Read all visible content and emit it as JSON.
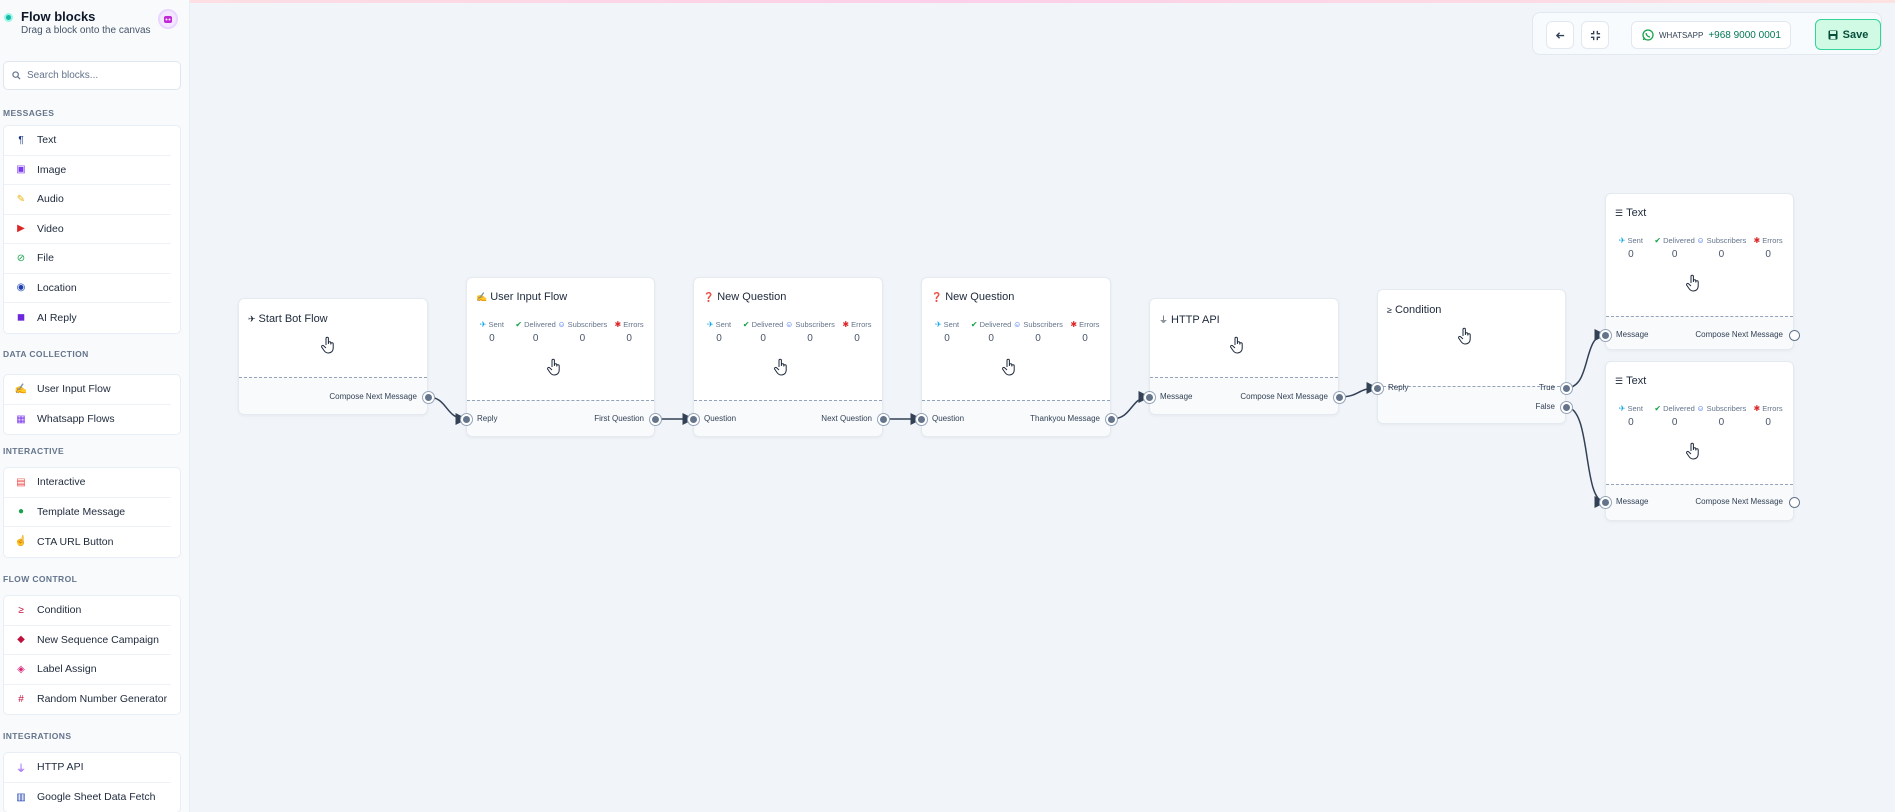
{
  "sidebar": {
    "title": "Flow blocks",
    "subtitle": "Drag a block onto the canvas",
    "search_placeholder": "Search blocks...",
    "sections": [
      {
        "label": "MESSAGES",
        "items": [
          {
            "label": "Text",
            "icon": "paragraph-icon",
            "color": "#1e3a8a"
          },
          {
            "label": "Image",
            "icon": "image-icon",
            "color": "#7c3aed"
          },
          {
            "label": "Audio",
            "icon": "audio-icon",
            "color": "#eab308"
          },
          {
            "label": "Video",
            "icon": "video-icon",
            "color": "#dc2626"
          },
          {
            "label": "File",
            "icon": "paperclip-icon",
            "color": "#16a34a"
          },
          {
            "label": "Location",
            "icon": "location-icon",
            "color": "#1e40af"
          },
          {
            "label": "AI Reply",
            "icon": "robot-icon",
            "color": "#6d28d9"
          }
        ]
      },
      {
        "label": "DATA COLLECTION",
        "items": [
          {
            "label": "User Input Flow",
            "icon": "user-input-icon",
            "color": "#16a34a"
          },
          {
            "label": "Whatsapp Flows",
            "icon": "flows-icon",
            "color": "#7c3aed"
          }
        ]
      },
      {
        "label": "INTERACTIVE",
        "items": [
          {
            "label": "Interactive",
            "icon": "newspaper-icon",
            "color": "#ef4444"
          },
          {
            "label": "Template Message",
            "icon": "palette-icon",
            "color": "#16a34a"
          },
          {
            "label": "CTA URL Button",
            "icon": "pointer-icon",
            "color": "#be123c"
          }
        ]
      },
      {
        "label": "FLOW CONTROL",
        "items": [
          {
            "label": "Condition",
            "icon": "greater-equal-icon",
            "color": "#be123c"
          },
          {
            "label": "New Sequence Campaign",
            "icon": "drop-icon",
            "color": "#be123c"
          },
          {
            "label": "Label Assign",
            "icon": "tag-icon",
            "color": "#db2777"
          },
          {
            "label": "Random Number Generator",
            "icon": "hash-icon",
            "color": "#be123c"
          }
        ]
      },
      {
        "label": "INTEGRATIONS",
        "items": [
          {
            "label": "HTTP API",
            "icon": "plug-icon",
            "color": "#7c3aed"
          },
          {
            "label": "Google Sheet Data Fetch",
            "icon": "sheet-icon",
            "color": "#1e40af"
          }
        ]
      }
    ]
  },
  "toolbar": {
    "back_icon": "arrow-left-icon",
    "fit_icon": "compress-icon",
    "whatsapp_label": "WHATSAPP",
    "whatsapp_number": "+968 9000 0001",
    "save_label": "Save"
  },
  "stat_labels": {
    "sent": "Sent",
    "delivered": "Delivered",
    "subscribers": "Subscribers",
    "errors": "Errors"
  },
  "nodes": {
    "start": {
      "title": "Start Bot Flow",
      "out": "Compose Next Message"
    },
    "user_input": {
      "title": "User Input Flow",
      "in": "Reply",
      "out": "First Question",
      "stats": [
        "0",
        "0",
        "0",
        "0"
      ]
    },
    "question1": {
      "title": "New Question",
      "in": "Question",
      "out": "Next Question",
      "stats": [
        "0",
        "0",
        "0",
        "0"
      ]
    },
    "question2": {
      "title": "New Question",
      "in": "Question",
      "out": "Thankyou Message",
      "stats": [
        "0",
        "0",
        "0",
        "0"
      ]
    },
    "http": {
      "title": "HTTP API",
      "in": "Message",
      "out": "Compose Next Message"
    },
    "condition": {
      "title": "Condition",
      "in": "Reply",
      "out_true": "True",
      "out_false": "False"
    },
    "text1": {
      "title": "Text",
      "in": "Message",
      "out": "Compose Next Message",
      "stats": [
        "0",
        "0",
        "0",
        "0"
      ]
    },
    "text2": {
      "title": "Text",
      "in": "Message",
      "out": "Compose Next Message",
      "stats": [
        "0",
        "0",
        "0",
        "0"
      ]
    }
  }
}
